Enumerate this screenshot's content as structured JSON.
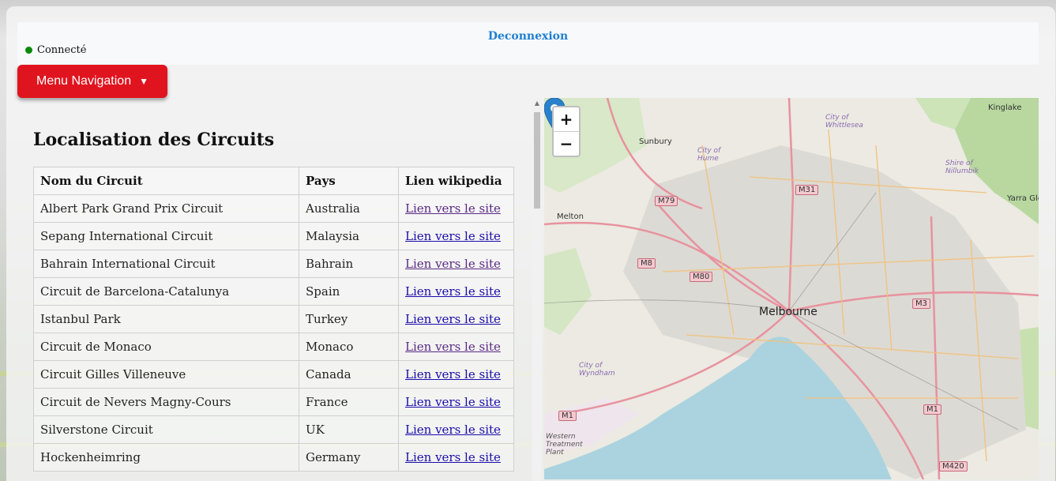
{
  "header": {
    "logout_label": "Deconnexion",
    "status_label": "Connecté",
    "status_color": "#0a8a0a"
  },
  "menu": {
    "label": "Menu Navigation",
    "arrow": "▼"
  },
  "page": {
    "title": "Localisation des Circuits"
  },
  "table": {
    "headers": [
      "Nom du Circuit",
      "Pays",
      "Lien wikipedia"
    ],
    "rows": [
      {
        "name": "Albert Park Grand Prix Circuit",
        "country": "Australia",
        "link": "Lien vers le site",
        "visited": true
      },
      {
        "name": "Sepang International Circuit",
        "country": "Malaysia",
        "link": "Lien vers le site",
        "visited": false
      },
      {
        "name": "Bahrain International Circuit",
        "country": "Bahrain",
        "link": "Lien vers le site",
        "visited": true
      },
      {
        "name": "Circuit de Barcelona-Catalunya",
        "country": "Spain",
        "link": "Lien vers le site",
        "visited": false
      },
      {
        "name": "Istanbul Park",
        "country": "Turkey",
        "link": "Lien vers le site",
        "visited": false
      },
      {
        "name": "Circuit de Monaco",
        "country": "Monaco",
        "link": "Lien vers le site",
        "visited": true
      },
      {
        "name": "Circuit Gilles Villeneuve",
        "country": "Canada",
        "link": "Lien vers le site",
        "visited": false
      },
      {
        "name": "Circuit de Nevers Magny-Cours",
        "country": "France",
        "link": "Lien vers le site",
        "visited": false
      },
      {
        "name": "Silverstone Circuit",
        "country": "UK",
        "link": "Lien vers le site",
        "visited": false
      },
      {
        "name": "Hockenheimring",
        "country": "Germany",
        "link": "Lien vers le site",
        "visited": false
      }
    ]
  },
  "map": {
    "zoom_in": "+",
    "zoom_out": "−",
    "labels": {
      "melbourne": "Melbourne",
      "sunbury": "Sunbury",
      "melton": "Melton",
      "kinglake": "Kinglake",
      "yarra": "Yarra Gle",
      "whittlesea": "City of Whittlesea",
      "hume": "City of Hume",
      "nillumbik": "Shire of Nillumbik",
      "wyndham": "City of Wyndham",
      "western": "Western Treatment Plant"
    },
    "shields": [
      "M79",
      "M31",
      "M8",
      "M80",
      "M3",
      "M1",
      "M1",
      "M420"
    ],
    "pin_color": "#2a81cb"
  }
}
